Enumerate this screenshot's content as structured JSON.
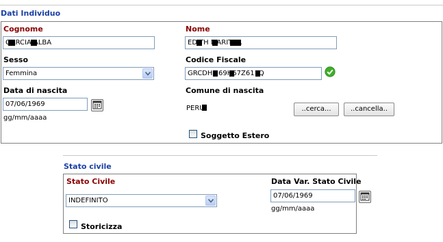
{
  "dati_individuo": {
    "title": "Dati Individuo",
    "cognome": {
      "label": "Cognome",
      "value": "GARCIA ALBA"
    },
    "nome": {
      "label": "Nome",
      "value": "EDITH MARITZA"
    },
    "sesso": {
      "label": "Sesso",
      "value": "Femmina"
    },
    "codice_fiscale": {
      "label": "Codice Fiscale",
      "value": "GRCDHM69H67Z611Q",
      "status_icon": "check-circle-icon"
    },
    "data_nascita": {
      "label": "Data di nascita",
      "value": "07/06/1969",
      "format_hint": "gg/mm/aaaa",
      "calendar_icon": "calendar-icon"
    },
    "comune_nascita": {
      "label": "Comune di nascita",
      "value": "PERU",
      "cerca_label": "..cerca...",
      "cancella_label": "..cancella.."
    },
    "soggetto_estero": {
      "label": "Soggetto Estero",
      "checked": false
    }
  },
  "stato_civile_section": {
    "title": "Stato civile",
    "stato_civile": {
      "label": "Stato Civile",
      "value": "INDEFINITO"
    },
    "data_var": {
      "label": "Data Var. Stato Civile",
      "value": "07/06/1969",
      "format_hint": "gg/mm/aaaa",
      "calendar_icon": "calendar-icon"
    },
    "storicizza": {
      "label": "Storicizza",
      "checked": false
    }
  },
  "colors": {
    "section_title": "#1a3fa6",
    "required_label": "#8b0000",
    "check_ok": "#3fae2a"
  }
}
